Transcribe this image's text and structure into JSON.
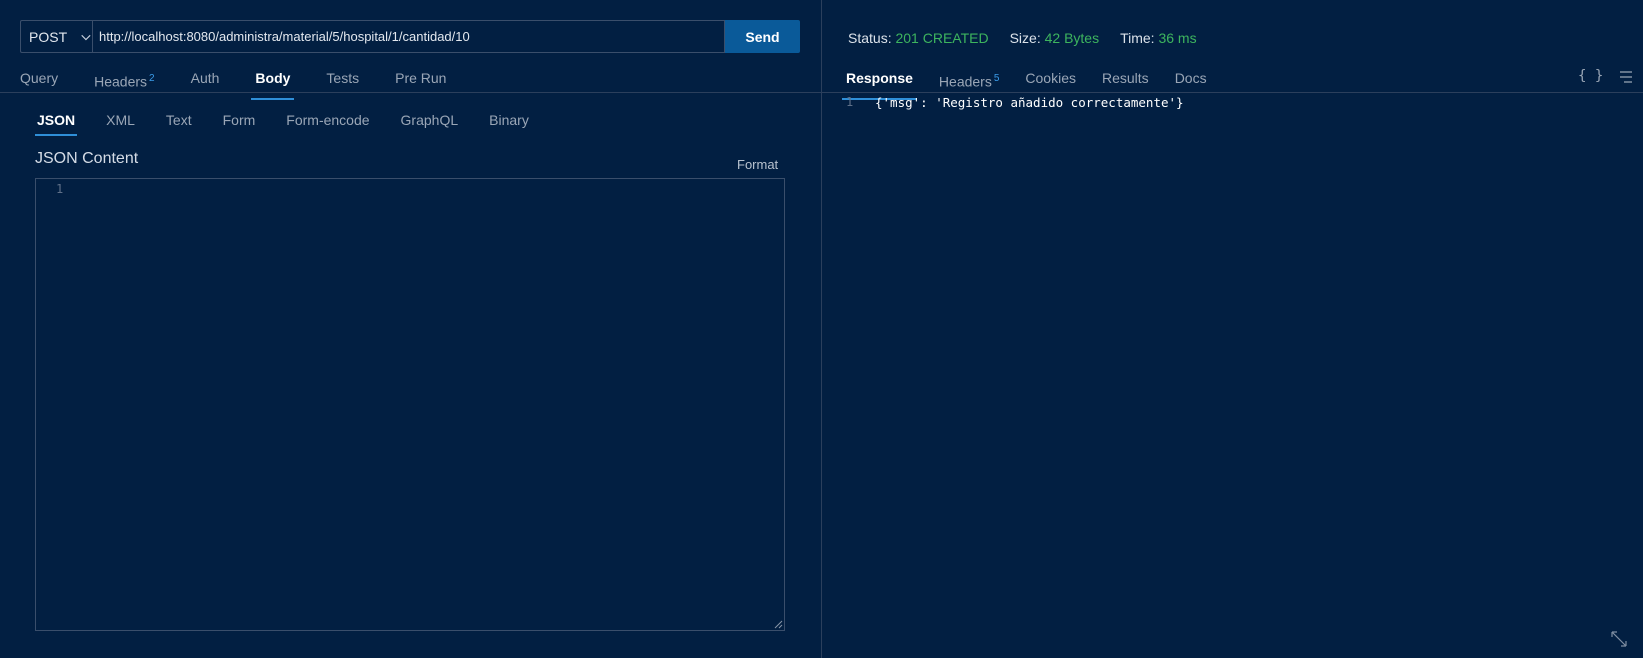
{
  "request": {
    "method": "POST",
    "url": "http://localhost:8080/administra/material/5/hospital/1/cantidad/10",
    "send_label": "Send"
  },
  "request_tabs": [
    {
      "label": "Query",
      "badge": ""
    },
    {
      "label": "Headers",
      "badge": "2"
    },
    {
      "label": "Auth",
      "badge": ""
    },
    {
      "label": "Body",
      "badge": ""
    },
    {
      "label": "Tests",
      "badge": ""
    },
    {
      "label": "Pre Run",
      "badge": ""
    }
  ],
  "active_request_tab": "Body",
  "body_tabs": [
    "JSON",
    "XML",
    "Text",
    "Form",
    "Form-encode",
    "GraphQL",
    "Binary"
  ],
  "active_body_tab": "JSON",
  "json_content": {
    "title": "JSON Content",
    "format_label": "Format",
    "line_number": "1"
  },
  "response_status": {
    "status_label": "Status:",
    "status_value": "201 CREATED",
    "size_label": "Size:",
    "size_value": "42 Bytes",
    "time_label": "Time:",
    "time_value": "36 ms",
    "value_color": "#3db45e"
  },
  "response_tabs": [
    {
      "label": "Response",
      "badge": ""
    },
    {
      "label": "Headers",
      "badge": "5"
    },
    {
      "label": "Cookies",
      "badge": ""
    },
    {
      "label": "Results",
      "badge": ""
    },
    {
      "label": "Docs",
      "badge": ""
    }
  ],
  "active_response_tab": "Response",
  "response_body": {
    "line_number": "1",
    "text": "{'msg': 'Registro añadido correctamente'}"
  },
  "icons": {
    "braces": "{ }",
    "wrap": "wrap-lines-icon",
    "expand": "expand-icon"
  }
}
